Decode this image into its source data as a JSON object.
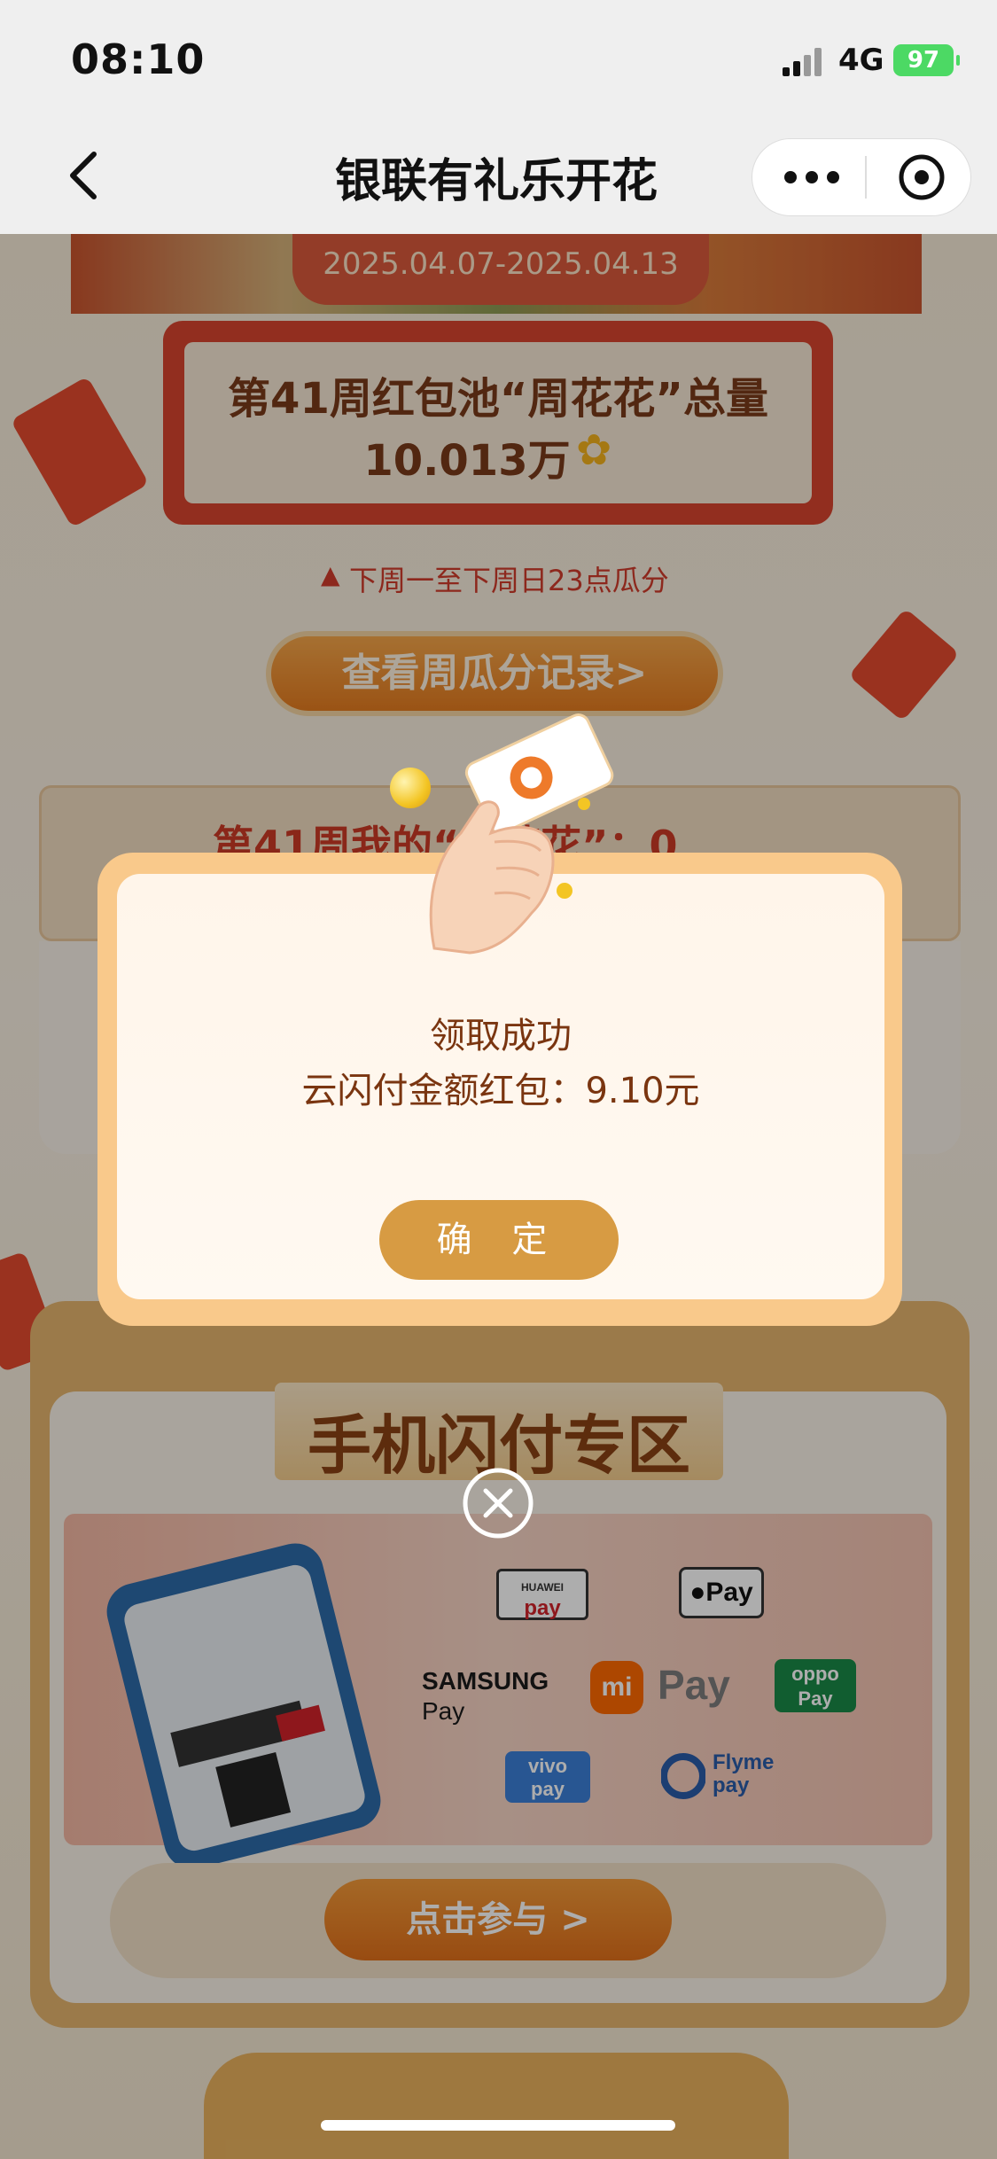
{
  "status_bar": {
    "time": "08:10",
    "network": "4G",
    "battery": "97"
  },
  "nav": {
    "title": "银联有礼乐开花"
  },
  "page": {
    "date_range": "2025.04.07-2025.04.13",
    "pool_title": "第41周红包池“周花花”总量",
    "pool_amount": "10.013万",
    "reminder": "下周一至下周日23点瓜分",
    "record_button": "查看周瓜分记录>",
    "my_flowers_label": "第41周我的“周花花”：0",
    "zone_title": "手机闪付专区",
    "join_button": "点击参与 >",
    "pay_logos": {
      "huawei_top": "HUAWEI",
      "huawei_bottom": "pay",
      "apple": "Pay",
      "samsung_top": "SAMSUNG",
      "samsung_bottom": "Pay",
      "mi_badge": "mi",
      "mi_text": "Pay",
      "oppo_top": "oppo",
      "oppo_bottom": "Pay",
      "vivo_top": "vivo",
      "vivo_bottom": "pay",
      "flyme_top": "Flyme",
      "flyme_bottom": "pay"
    }
  },
  "modal": {
    "title": "领取成功",
    "amount_text": "云闪付金额红包：9.10元",
    "confirm_button": "确 定"
  },
  "colors": {
    "accent_orange": "#e47b1f",
    "gold": "#d79b43",
    "red": "#d8452e",
    "modal_text": "#7a3510"
  }
}
